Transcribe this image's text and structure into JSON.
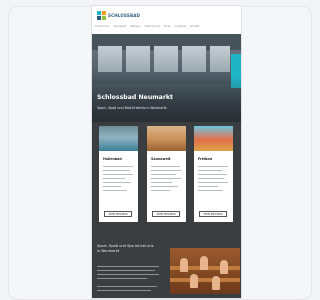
{
  "brand": {
    "logo_text": "SCHLOSSBAD",
    "colors": {
      "accent": "#1fb5c5",
      "dark": "#3b3e41"
    }
  },
  "nav": [
    "Schwimmen",
    "Saunawelt",
    "Wellness",
    "Gastronomie",
    "Kurse",
    "Angebote",
    "Kontakt"
  ],
  "hero": {
    "title": "Schlossbad Neumarkt",
    "subtitle": "Sport, Spaß und Bad-Erlebnis in Neumarkt"
  },
  "cards": [
    {
      "title": "Hallenbad",
      "button": "MEHR ERFAHREN"
    },
    {
      "title": "Saunawelt",
      "button": "MEHR ERFAHREN"
    },
    {
      "title": "Freibad",
      "button": "MEHR ERFAHREN"
    }
  ],
  "section2": {
    "title": "Sport, Spaß und Spa ist bei uns in Neumarkt"
  }
}
